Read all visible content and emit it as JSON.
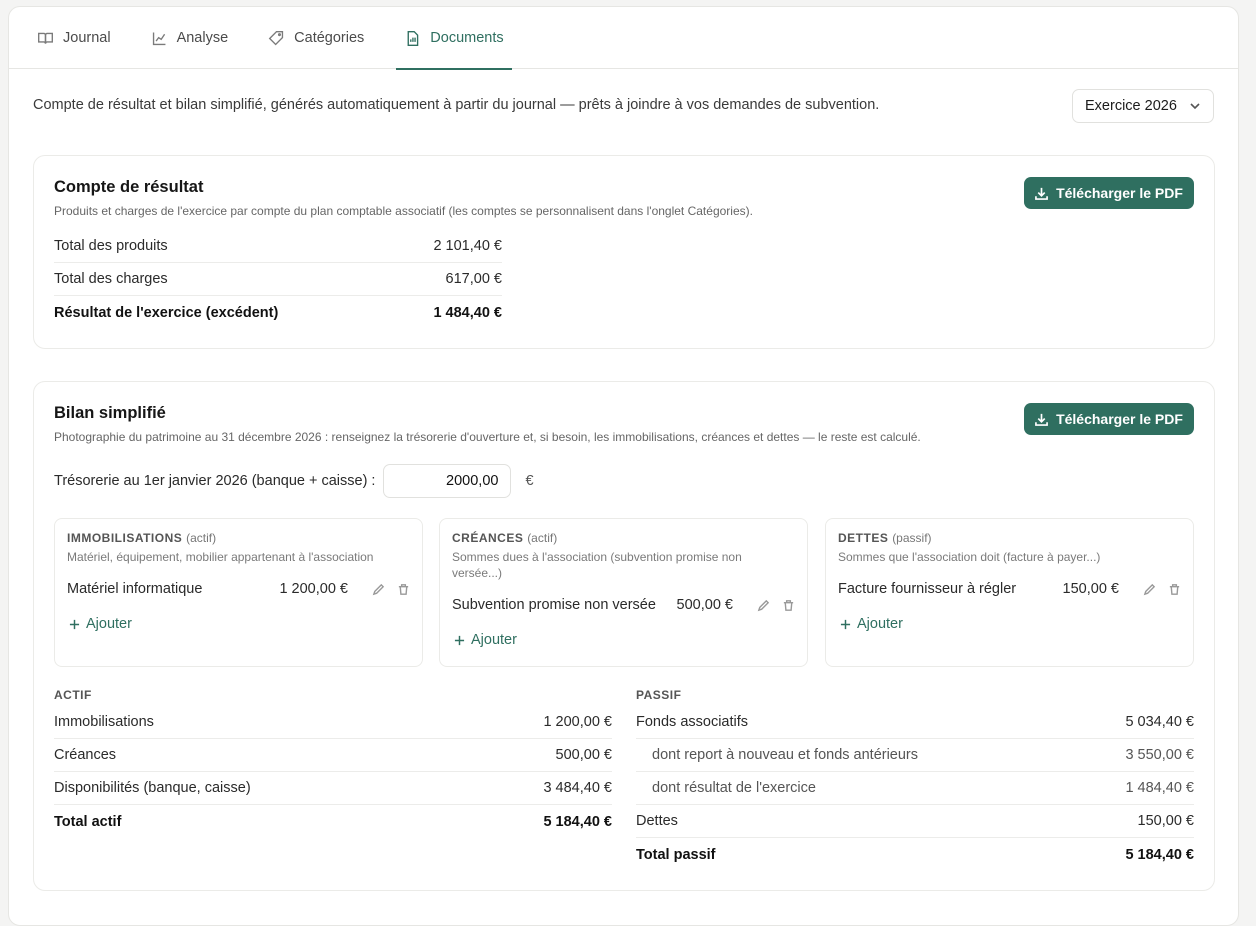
{
  "tabs": [
    {
      "label": "Journal",
      "icon": "book-icon"
    },
    {
      "label": "Analyse",
      "icon": "chart-line-icon"
    },
    {
      "label": "Catégories",
      "icon": "tag-icon"
    },
    {
      "label": "Documents",
      "icon": "document-icon",
      "active": true
    }
  ],
  "intro": "Compte de résultat et bilan simplifié, générés automatiquement à partir du journal — prêts à joindre à vos demandes de subvention.",
  "year_select": "Exercice 2026",
  "download_label": "Télécharger le PDF",
  "compte": {
    "title": "Compte de résultat",
    "subtitle": "Produits et charges de l'exercice par compte du plan comptable associatif (les comptes se personnalisent dans l'onglet Catégories).",
    "rows": [
      {
        "label": "Total des produits",
        "value": "2 101,40 €"
      },
      {
        "label": "Total des charges",
        "value": "617,00 €"
      },
      {
        "label": "Résultat de l'exercice (excédent)",
        "value": "1 484,40 €"
      }
    ]
  },
  "bilan": {
    "title": "Bilan simplifié",
    "subtitle": "Photographie du patrimoine au 31 décembre 2026 : renseignez la trésorerie d'ouverture et, si besoin, les immobilisations, créances et dettes — le reste est calculé.",
    "treso_label": "Trésorerie au 1er janvier 2026 (banque + caisse) :",
    "treso_value": "2000,00",
    "treso_currency": "€",
    "add_label": "Ajouter",
    "boxes": {
      "immo": {
        "title": "IMMOBILISATIONS",
        "kind": "(actif)",
        "desc": "Matériel, équipement, mobilier appartenant à l'association",
        "item_label": "Matériel informatique",
        "item_value": "1 200,00 €"
      },
      "creances": {
        "title": "CRÉANCES",
        "kind": "(actif)",
        "desc": "Sommes dues à l'association (subvention promise non versée...)",
        "item_label": "Subvention promise non versée",
        "item_value": "500,00 €"
      },
      "dettes": {
        "title": "DETTES",
        "kind": "(passif)",
        "desc": "Sommes que l'association doit (facture à payer...)",
        "item_label": "Facture fournisseur à régler",
        "item_value": "150,00 €"
      }
    },
    "actif_header": "ACTIF",
    "actif": [
      {
        "label": "Immobilisations",
        "value": "1 200,00 €"
      },
      {
        "label": "Créances",
        "value": "500,00 €"
      },
      {
        "label": "Disponibilités (banque, caisse)",
        "value": "3 484,40 €"
      },
      {
        "label": "Total actif",
        "value": "5 184,40 €"
      }
    ],
    "passif_header": "PASSIF",
    "passif": [
      {
        "label": "Fonds associatifs",
        "value": "5 034,40 €"
      },
      {
        "label": "dont report à nouveau et fonds antérieurs",
        "value": "3 550,00 €"
      },
      {
        "label": "dont résultat de l'exercice",
        "value": "1 484,40 €"
      },
      {
        "label": "Dettes",
        "value": "150,00 €"
      },
      {
        "label": "Total passif",
        "value": "5 184,40 €"
      }
    ]
  },
  "colors": {
    "accent": "#2f6f60"
  }
}
